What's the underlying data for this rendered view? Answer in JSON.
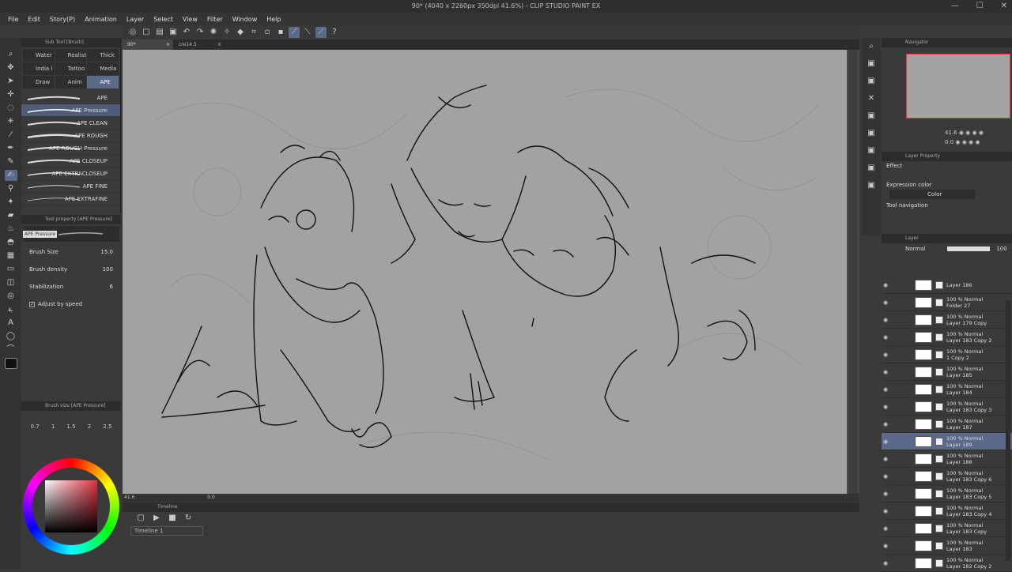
{
  "window": {
    "title": "90* (4040 x 2260px 350dpi 41.6%) - CLIP STUDIO PAINT EX"
  },
  "menu": [
    "File",
    "Edit",
    "Story(P)",
    "Animation",
    "Layer",
    "Select",
    "View",
    "Filter",
    "Window",
    "Help"
  ],
  "document_tabs": [
    {
      "label": "90*"
    },
    {
      "label": "cre14.5"
    }
  ],
  "subtool": {
    "header": "Sub Tool [Brush]",
    "tabs": [
      "Water",
      "Realist",
      "Thick",
      "India i",
      "Tattoo",
      "Media",
      "Draw",
      "Anim",
      "APE"
    ],
    "selected_tab": "APE",
    "brushes": [
      "APE",
      "APE Pressure",
      "APE CLEAN",
      "APE ROUGH",
      "APE ROUGH Pressure",
      "APE CLOSEUP",
      "APE EXTRACLOSEUP",
      "APE FINE",
      "APE EXTRAFINE"
    ],
    "selected_brush": "APE Pressure"
  },
  "tool_property": {
    "header": "Tool property [APE Pressure]",
    "preset": "APE Pressure",
    "brush_size_label": "Brush Size",
    "brush_size_value": "15.0",
    "brush_density_label": "Brush density",
    "brush_density_value": "100",
    "stabilization_label": "Stabilization",
    "stabilization_value": "6",
    "adjust_by_speed": "Adjust by speed"
  },
  "brush_size_panel": {
    "header": "Brush size [APE Pressure]",
    "sizes": [
      "0.7",
      "1",
      "1.5",
      "2",
      "2.5"
    ]
  },
  "status": {
    "zoom": "41.6",
    "angle": "0.0"
  },
  "timeline": {
    "header": "Timeline",
    "name": "Timeline 1"
  },
  "navigator": {
    "header": "Navigator",
    "zoom": "41.6",
    "angle": "0.0"
  },
  "layer_property": {
    "header": "Layer Property",
    "effect": "Effect",
    "expression_color": "Expression color",
    "color_value": "Color",
    "tool_navigation": "Tool navigation"
  },
  "layer_panel": {
    "header": "Layer",
    "blend": "Normal",
    "opacity": "100",
    "layers": [
      {
        "name": "Layer 186",
        "mode": "",
        "kind": "layer"
      },
      {
        "name": "Folder 27",
        "mode": "100 % Normal",
        "kind": "folder"
      },
      {
        "name": "Layer 179 Copy",
        "mode": "100 % Normal",
        "kind": "layer"
      },
      {
        "name": "Layer 183 Copy 2",
        "mode": "100 % Normal",
        "kind": "layer"
      },
      {
        "name": "1 Copy 2",
        "mode": "100 % Normal",
        "kind": "layer"
      },
      {
        "name": "Layer 185",
        "mode": "100 % Normal",
        "kind": "layer"
      },
      {
        "name": "Layer 184",
        "mode": "100 % Normal",
        "kind": "layer"
      },
      {
        "name": "Layer 183 Copy 3",
        "mode": "100 % Normal",
        "kind": "layer"
      },
      {
        "name": "Layer 187",
        "mode": "100 % Normal",
        "kind": "layer"
      },
      {
        "name": "Layer 189",
        "mode": "100 % Normal",
        "kind": "layer",
        "selected": true
      },
      {
        "name": "Layer 188",
        "mode": "100 % Normal",
        "kind": "layer"
      },
      {
        "name": "Layer 183 Copy 6",
        "mode": "100 % Normal",
        "kind": "layer"
      },
      {
        "name": "Layer 183 Copy 5",
        "mode": "100 % Normal",
        "kind": "layer"
      },
      {
        "name": "Layer 183 Copy 4",
        "mode": "100 % Normal",
        "kind": "layer"
      },
      {
        "name": "Layer 183 Copy",
        "mode": "100 % Normal",
        "kind": "layer"
      },
      {
        "name": "Layer 183",
        "mode": "100 % Normal",
        "kind": "layer"
      },
      {
        "name": "Layer 182 Copy 2",
        "mode": "100 % Normal",
        "kind": "layer"
      }
    ]
  },
  "colors": {
    "accent": "#5b6a8a",
    "paper": "#a2a2a2",
    "ink": "#111111"
  }
}
